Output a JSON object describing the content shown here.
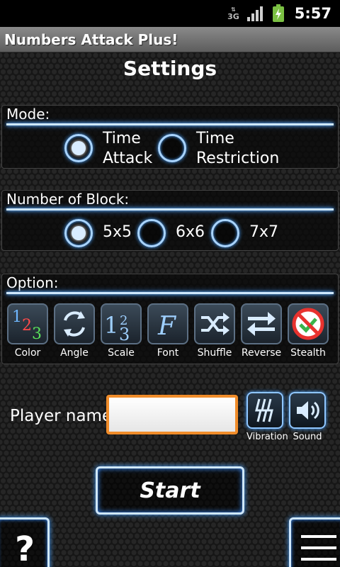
{
  "status_bar": {
    "network": "3G",
    "time": "5:57"
  },
  "app": {
    "title": "Numbers Attack Plus!"
  },
  "page": {
    "title": "Settings"
  },
  "mode": {
    "label": "Mode:",
    "options": [
      {
        "line1": "Time",
        "line2": "Attack",
        "selected": true
      },
      {
        "line1": "Time",
        "line2": "Restriction",
        "selected": false
      }
    ]
  },
  "blocks": {
    "label": "Number of Block:",
    "options": [
      {
        "label": "5x5",
        "selected": true
      },
      {
        "label": "6x6",
        "selected": false
      },
      {
        "label": "7x7",
        "selected": false
      }
    ]
  },
  "option": {
    "label": "Option:",
    "items": [
      {
        "label": "Color",
        "icon": "color-numbers-icon"
      },
      {
        "label": "Angle",
        "icon": "rotate-arrows-icon"
      },
      {
        "label": "Scale",
        "icon": "scale-numbers-icon"
      },
      {
        "label": "Font",
        "icon": "font-f-icon"
      },
      {
        "label": "Shuffle",
        "icon": "shuffle-icon"
      },
      {
        "label": "Reverse",
        "icon": "reverse-arrows-icon"
      },
      {
        "label": "Stealth",
        "icon": "stealth-no-icon"
      }
    ]
  },
  "player": {
    "label": "Player name",
    "value": "",
    "placeholder": ""
  },
  "vibration": {
    "label": "Vibration",
    "icon": "vibration-icon"
  },
  "sound": {
    "label": "Sound",
    "icon": "speaker-icon"
  },
  "start": {
    "label": "Start"
  },
  "help": {
    "label": "?"
  },
  "colors": {
    "accent_glow": "#4aa3ff",
    "input_border": "#f08c2a"
  }
}
